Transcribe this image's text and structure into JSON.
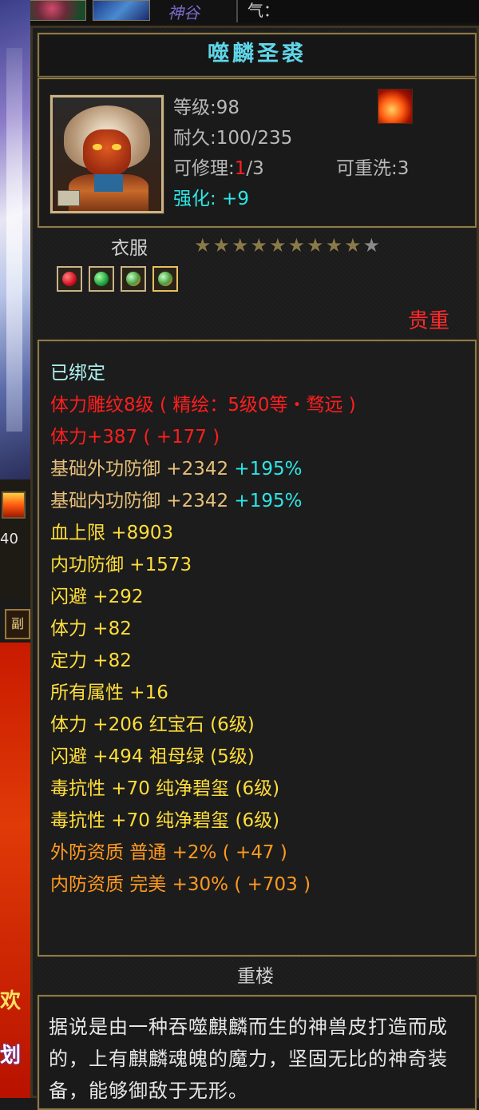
{
  "top_bar": {
    "qi_label": "气：",
    "logo_text": "神谷"
  },
  "left_strip": {
    "number": "40",
    "button_char": "副",
    "text1": "欢",
    "text2": "划"
  },
  "item": {
    "name": "噬麟圣裘",
    "level": "等级:98",
    "durability": {
      "prefix": "耐久:",
      "value": "100/235"
    },
    "repair": {
      "label": "可修理:",
      "current": "1",
      "total": "/3"
    },
    "rewash": "可重洗:3",
    "enhance": "强化: +9",
    "slot": "衣服",
    "stars": {
      "filled": 9,
      "total": 10
    },
    "gems": [
      "red",
      "green",
      "jade",
      "jade"
    ],
    "rarity": "贵重"
  },
  "attributes": [
    {
      "text": "已绑定",
      "color": "cyan"
    },
    {
      "text": "体力雕纹8级 ( 精绘：5级0等・骛远 )",
      "color": "red"
    },
    {
      "text": "体力+387 ( +177 )",
      "color": "red"
    },
    {
      "text": "基础外功防御 +2342",
      "extra": " +195%",
      "color": "gold"
    },
    {
      "text": "基础内功防御 +2342",
      "extra": " +195%",
      "color": "gold"
    },
    {
      "text": "血上限 +8903",
      "color": "yellow"
    },
    {
      "text": "内功防御 +1573",
      "color": "yellow"
    },
    {
      "text": "闪避 +292",
      "color": "yellow"
    },
    {
      "text": "体力 +82",
      "color": "yellow"
    },
    {
      "text": "定力 +82",
      "color": "yellow"
    },
    {
      "text": "所有属性 +16",
      "color": "yellow"
    },
    {
      "text": "体力 +206 红宝石 (6级)",
      "color": "yellow"
    },
    {
      "text": "闪避 +494 祖母绿 (5级)",
      "color": "yellow"
    },
    {
      "text": "毒抗性 +70 纯净碧玺 (6级)",
      "color": "yellow"
    },
    {
      "text": "毒抗性 +70 纯净碧玺 (6级)",
      "color": "yellow"
    },
    {
      "text": "外防资质  普通 +2% ( +47 )",
      "color": "orange"
    },
    {
      "text": "内防资质  完美 +30% ( +703 )",
      "color": "orange"
    }
  ],
  "weight_label": "重楼",
  "description": "据说是由一种吞噬麒麟而生的神兽皮打造而成的，上有麒麟魂魄的魔力，坚固无比的神奇装备，能够御敌于无形。"
}
